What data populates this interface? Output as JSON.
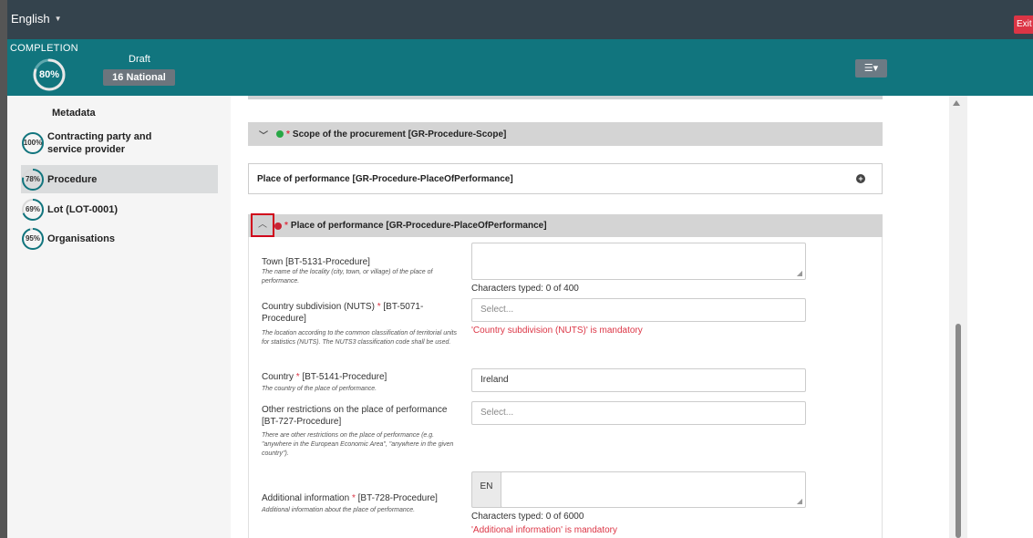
{
  "header": {
    "language": "English",
    "exit_label": "Exit"
  },
  "completion": {
    "label": "COMPLETION",
    "percent_text": "80%",
    "percent_value": 80,
    "status": "Draft",
    "notice_type": "16 National",
    "colors": {
      "teal": "#11757e",
      "ring": "#e0e0e0"
    }
  },
  "sidebar": {
    "title": "Metadata",
    "items": [
      {
        "percent": "100%",
        "value": 100,
        "label_line1": "Contracting party and",
        "label_line2": "service provider"
      },
      {
        "percent": "78%",
        "value": 78,
        "label_line1": "Procedure",
        "label_line2": ""
      },
      {
        "percent": "69%",
        "value": 69,
        "label_line1": "Lot (LOT-0001)",
        "label_line2": ""
      },
      {
        "percent": "95%",
        "value": 95,
        "label_line1": "Organisations",
        "label_line2": ""
      }
    ]
  },
  "sections": {
    "scope_title": "Scope of the procurement  [GR-Procedure-Scope]",
    "pop_title": "Place of performance  [GR-Procedure-PlaceOfPerformance]",
    "pop2_title": "Place of performance  [GR-Procedure-PlaceOfPerformance]"
  },
  "fields": {
    "town": {
      "label": "Town [BT-5131-Procedure]",
      "help": "The name of the locality (city, town, or village) of the place of performance.",
      "counter": "Characters typed: 0 of 400"
    },
    "nuts": {
      "label_main": "Country subdivision (NUTS)",
      "label_code": " [BT-5071-Procedure]",
      "help": "The location according to the common classification of territorial units for statistics (NUTS). The NUTS3 classification code shall be used.",
      "placeholder": "Select...",
      "error": "'Country subdivision (NUTS)' is mandatory"
    },
    "country": {
      "label_main": "Country",
      "label_code": " [BT-5141-Procedure]",
      "help": "The country of the place of performance.",
      "value": "Ireland"
    },
    "other": {
      "label": "Other restrictions on the place of performance [BT-727-Procedure]",
      "help": "There are other restrictions on the place of performance (e.g. \"anywhere in the European Economic Area\", \"anywhere in the given country\").",
      "placeholder": "Select..."
    },
    "additional": {
      "label_main": "Additional information",
      "label_code": " [BT-728-Procedure]",
      "help": "Additional information about the place of performance.",
      "lang": "EN",
      "counter": "Characters typed: 0 of 6000",
      "error": "'Additional information' is mandatory"
    }
  }
}
